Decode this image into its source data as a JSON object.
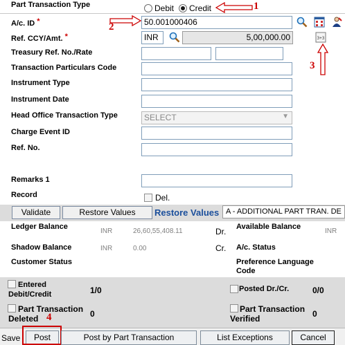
{
  "form": {
    "part_tran_type_label": "Part Transaction Type",
    "radio_debit": "Debit",
    "radio_credit": "Credit",
    "ac_id_label": "A/c. ID",
    "ac_id_value": "50.001000406",
    "ref_ccy_label": "Ref. CCY/Amt.",
    "ccy_value": "INR",
    "amount_value": "5,00,000.00",
    "treasury_label": "Treasury Ref. No./Rate",
    "tran_particulars_label": "Transaction Particulars Code",
    "instrument_type_label": "Instrument Type",
    "instrument_date_label": "Instrument Date",
    "head_office_label": "Head Office Transaction Type",
    "head_office_value": "SELECT",
    "charge_event_label": "Charge Event ID",
    "ref_no_label": "Ref. No.",
    "remarks_label": "Remarks 1",
    "record_label": "Record",
    "del_label": "Del."
  },
  "annotations": {
    "n1": "1",
    "n2": "2",
    "n3": "3",
    "n4": "4"
  },
  "toolbar": {
    "validate": "Validate",
    "restore_values_btn": "Restore Values",
    "restore_values_text": "Restore Values",
    "part_tran_dropdown": "A - ADDITIONAL PART TRAN. DE"
  },
  "balances": {
    "ledger_label": "Ledger Balance",
    "ledger_ccy": "INR",
    "ledger_amount": "26,60,55,408.11",
    "ledger_drcr": "Dr.",
    "available_label": "Available Balance",
    "available_ccy": "INR",
    "shadow_label": "Shadow Balance",
    "shadow_ccy": "INR",
    "shadow_amount": "0.00",
    "shadow_drcr": "Cr.",
    "ac_status_label": "A/c. Status",
    "customer_status_label": "Customer Status",
    "pref_lang_label": "Preference Language Code"
  },
  "summary": {
    "entered_label": "Entered Debit/Credit",
    "entered_value": "1/0",
    "posted_label": "Posted Dr./Cr.",
    "posted_value": "0/0",
    "pt_deleted_label": "Part Transaction Deleted",
    "pt_deleted_value": "0",
    "pt_verified_label": "Part Transaction Verified",
    "pt_verified_value": "0"
  },
  "footer": {
    "save": "Save",
    "post": "Post",
    "post_part": "Post by Part Transaction",
    "list_exceptions": "List Exceptions",
    "cancel": "Cancel"
  },
  "colors": {
    "annotation_red": "#cc0000",
    "band_grey": "#dcdcdc",
    "link_blue": "#1b4f9c"
  }
}
